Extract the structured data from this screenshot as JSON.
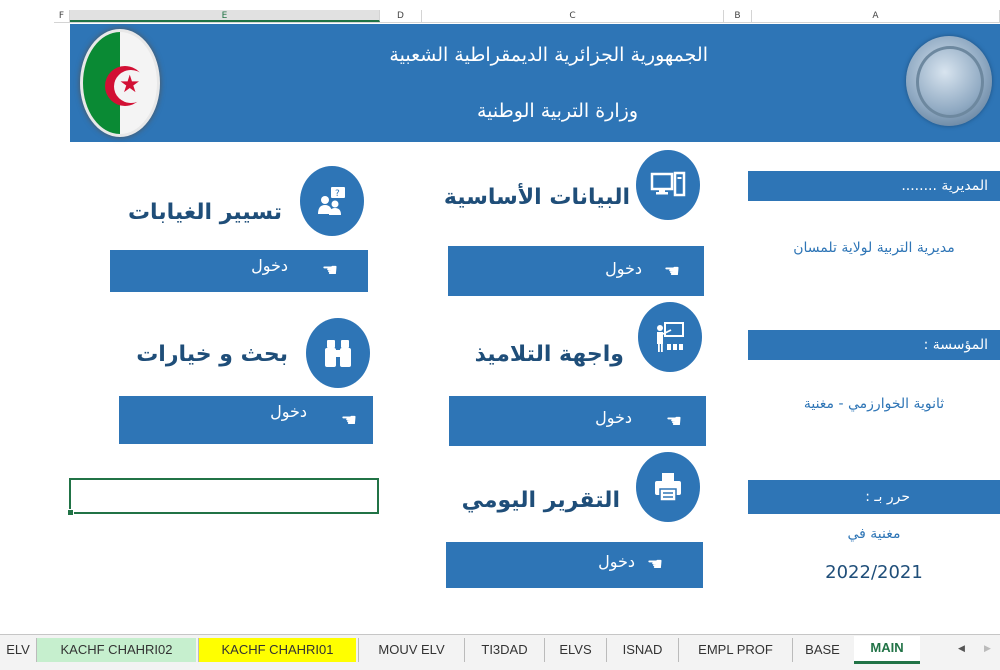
{
  "columns": [
    "F",
    "E",
    "D",
    "C",
    "B",
    "A"
  ],
  "banner": {
    "line1": "الجمهورية الجزائرية الديمقراطية الشعبية",
    "line2": "وزارة التربية الوطنية"
  },
  "info": {
    "directorate_label": "المديرية ........",
    "directorate_value": "مديرية التربية لولاية تلمسان",
    "institution_label": "المؤسسة :",
    "institution_value": "ثانوية الخوارزمي - مغنية",
    "editor_label": "حرر بـ :",
    "place": "مغنية في",
    "year": "2022/2021"
  },
  "tiles": {
    "basic_data": "البيانات الأساسية",
    "absences": "تسيير الغيابات",
    "students": "واجهة التلاميذ",
    "search": "بحث و خيارات",
    "daily_report": "التقرير اليومي",
    "enter_label": "دخول"
  },
  "sheet_tabs": [
    {
      "label": "ELV",
      "color": ""
    },
    {
      "label": "KACHF CHAHRI02",
      "color": "#c6efce"
    },
    {
      "label": "KACHF CHAHRI01",
      "color": "#ffff00"
    },
    {
      "label": "MOUV ELV",
      "color": ""
    },
    {
      "label": "TI3DAD",
      "color": ""
    },
    {
      "label": "ELVS",
      "color": ""
    },
    {
      "label": "ISNAD",
      "color": ""
    },
    {
      "label": "EMPL PROF",
      "color": ""
    },
    {
      "label": "BASE",
      "color": ""
    },
    {
      "label": "MAIN",
      "color": "",
      "active": true
    }
  ],
  "colors": {
    "accent": "#2e75b6",
    "title": "#1f4e79",
    "excel_green": "#217346"
  },
  "icons": [
    "computer-icon",
    "help-users-icon",
    "teacher-board-icon",
    "binoculars-icon",
    "printer-icon",
    "pointing-hand-icon"
  ]
}
